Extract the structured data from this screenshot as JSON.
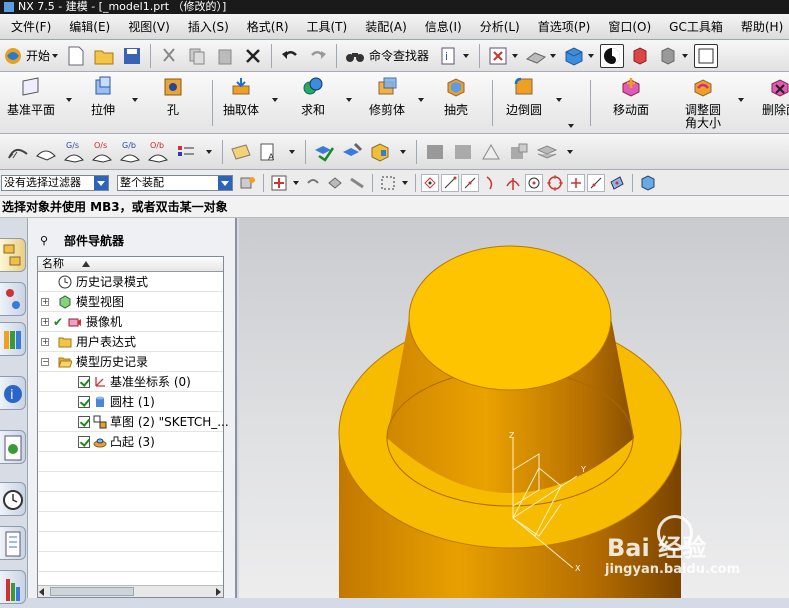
{
  "window": {
    "title": "NX 7.5 - 建模 - [_model1.prt （修改的）]"
  },
  "menu": [
    "文件(F)",
    "编辑(E)",
    "视图(V)",
    "插入(S)",
    "格式(R)",
    "工具(T)",
    "装配(A)",
    "信息(I)",
    "分析(L)",
    "首选项(P)",
    "窗口(O)",
    "GC工具箱",
    "帮助(H)"
  ],
  "toolbar1": {
    "start_label": "开始",
    "command_finder_label": "命令查找器"
  },
  "toolbar2": [
    {
      "label": "基准平面",
      "icon": "datum-plane-icon"
    },
    {
      "label": "拉伸",
      "icon": "extrude-icon"
    },
    {
      "label": "孔",
      "icon": "hole-icon"
    },
    {
      "label": "抽取体",
      "icon": "extract-body-icon"
    },
    {
      "label": "求和",
      "icon": "unite-icon"
    },
    {
      "label": "修剪体",
      "icon": "trim-body-icon"
    },
    {
      "label": "抽壳",
      "icon": "shell-icon"
    },
    {
      "label": "边倒圆",
      "icon": "edge-blend-icon"
    },
    {
      "label": "移动面",
      "icon": "move-face-icon"
    },
    {
      "label": "调整圆角大小",
      "icon": "resize-blend-icon"
    },
    {
      "label": "删除面",
      "icon": "delete-face-icon"
    }
  ],
  "toolbar3": {
    "icon_labels": [
      "G/s",
      "O/s",
      "G/b",
      "O/b"
    ]
  },
  "selection_bar": {
    "filter": "没有选择过滤器",
    "scope": "整个装配"
  },
  "prompt": "选择对象并使用 MB3，或者双击某一对象",
  "navigator": {
    "title": "部件导航器",
    "column": "名称",
    "nodes": [
      {
        "label": "历史记录模式",
        "icon": "clock-icon"
      },
      {
        "label": "模型视图",
        "icon": "model-views-icon"
      },
      {
        "label": "摄像机",
        "icon": "camera-icon"
      },
      {
        "label": "用户表达式",
        "icon": "folder-icon"
      },
      {
        "label": "模型历史记录",
        "icon": "open-folder-icon"
      },
      {
        "label": "基准坐标系 (0)",
        "icon": "datum-csys-icon"
      },
      {
        "label": "圆柱 (1)",
        "icon": "cylinder-icon"
      },
      {
        "label": "草图 (2) \"SKETCH_...",
        "icon": "sketch-icon"
      },
      {
        "label": "凸起 (3)",
        "icon": "emboss-icon"
      }
    ]
  },
  "viewport": {
    "axis_labels": {
      "x": "X",
      "y": "Y",
      "z": "Z"
    },
    "watermark": {
      "brand": "Bai 经验",
      "url": "jingyan.baidu.com"
    },
    "model_color": "#f0b400"
  }
}
